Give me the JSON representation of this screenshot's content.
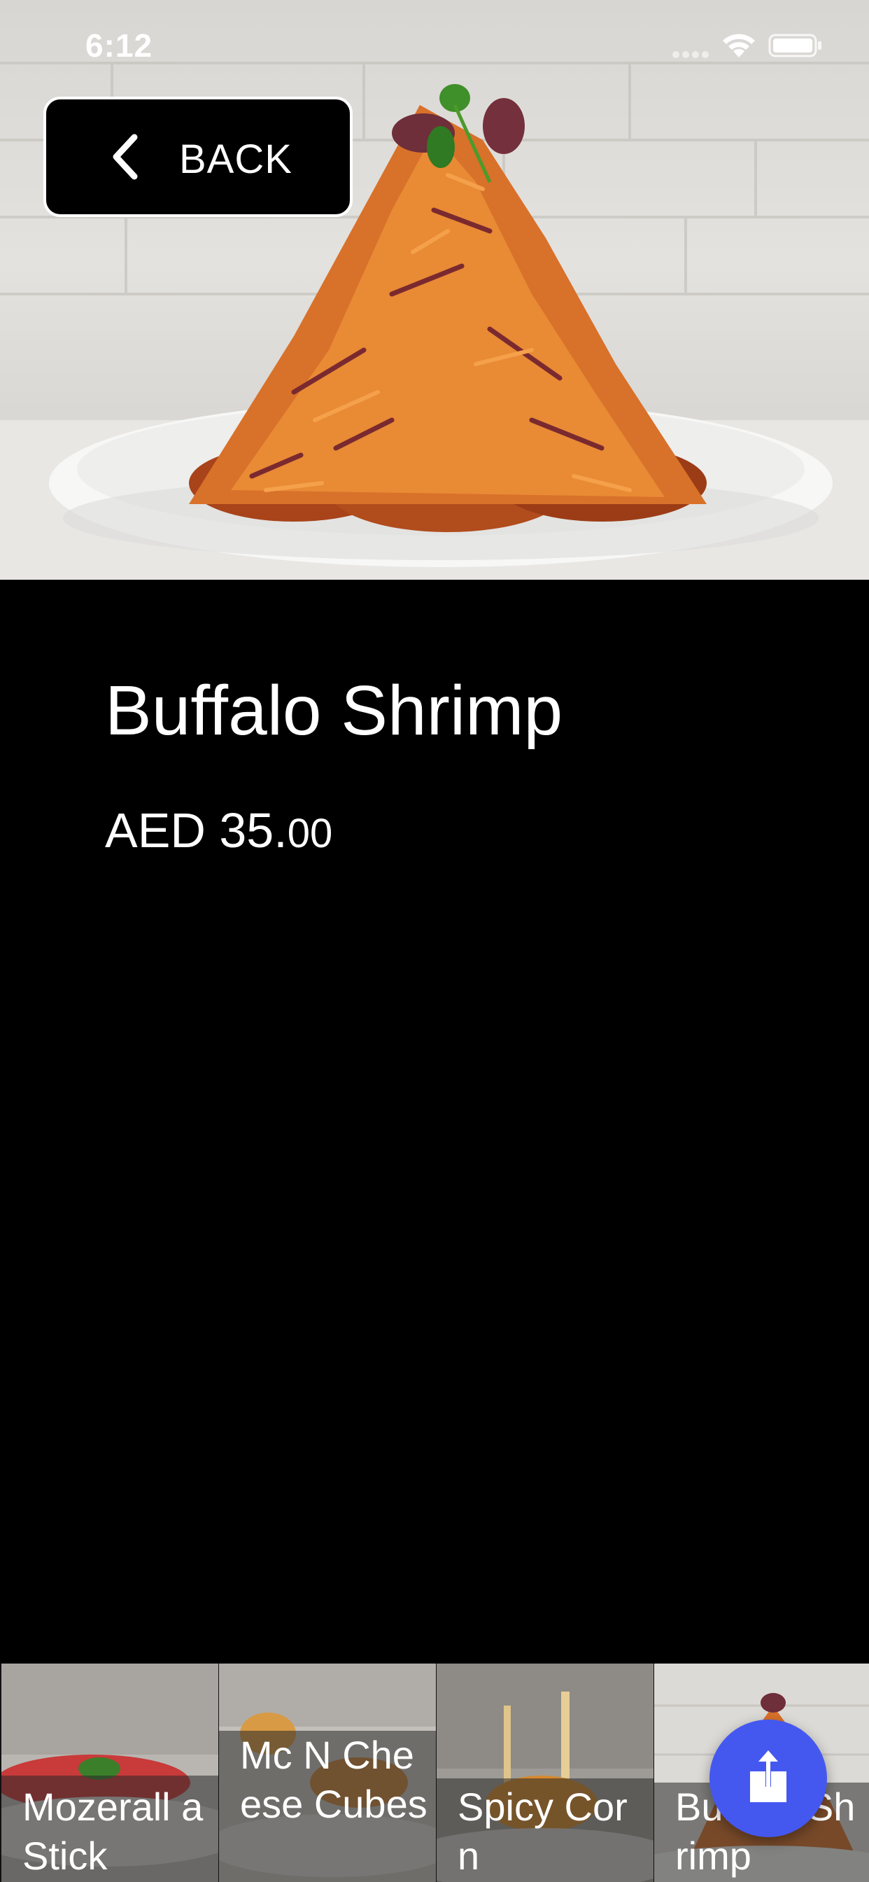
{
  "status_bar": {
    "time": "6:12",
    "icons": [
      "signal-icon",
      "wifi-icon",
      "battery-icon"
    ]
  },
  "header": {
    "back_label": "BACK",
    "back_icon": "chevron-left-icon"
  },
  "item": {
    "name": "Buffalo Shrimp",
    "price_main": "AED 35.",
    "price_decimals": "00",
    "photo": "buffalo-shrimp-dish-photo"
  },
  "carousel": {
    "items": [
      {
        "label": "Mozerall a Stick",
        "photo": "mozzarella-stick-photo"
      },
      {
        "label": "Mc N Cheese Cubes",
        "photo": "mac-n-cheese-cubes-photo"
      },
      {
        "label": "Spicy Corn",
        "photo": "spicy-corn-photo"
      },
      {
        "label": "Buffalo Shrimp",
        "photo": "buffalo-shrimp-photo"
      }
    ]
  },
  "share_button": {
    "icon": "share-icon",
    "color": "#4458f0"
  },
  "colors": {
    "background": "#000000",
    "text": "#ffffff",
    "accent": "#4458f0"
  }
}
